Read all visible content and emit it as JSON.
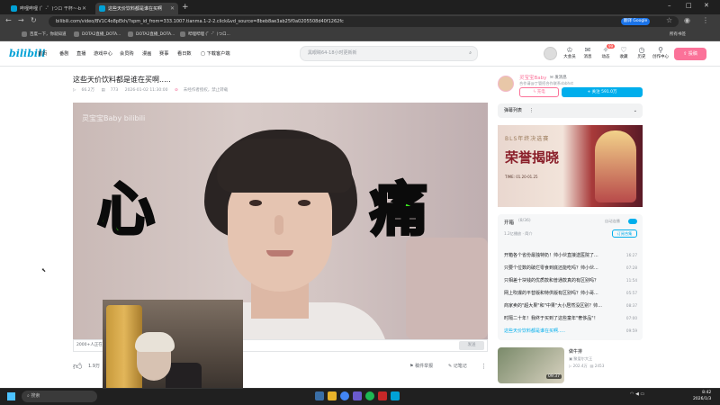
{
  "browser": {
    "tabs": [
      {
        "label": "哔哩哔哩 (゜-゜)つロ 干杯~-b",
        "active": false
      },
      {
        "label": "这些天价饮料都是谁在买啊",
        "active": true
      }
    ],
    "new_tab": "+",
    "window_controls": [
      "–",
      "□",
      "✕"
    ],
    "url": "bilibili.com/video/BV1C4o8pEkh/?spm_id_from=333.1007.tianma.1-2-2.click&vd_source=8beb8ae3ab25f0a0205508d40f1262fc",
    "google_button": "翻译 Google",
    "bookmarks": [
      "百度一下，你就知道",
      "DOTA2直播_DOTA...",
      "DOTA2直播_DOTA...",
      "哔哩哔哩 (゜-゜)つロ..."
    ],
    "all_bookmarks": "所有书签"
  },
  "header": {
    "logo": "bilibili",
    "nav": [
      "首页",
      "番剧",
      "直播",
      "游戏中心",
      "会员购",
      "漫画",
      "赛事",
      "看日数",
      "下载客户端"
    ],
    "search_placeholder": "黑眼睛64-18小时更新新",
    "icons": [
      {
        "label": "大会员",
        "icon": "vip-icon"
      },
      {
        "label": "消息",
        "icon": "message-icon"
      },
      {
        "label": "动态",
        "icon": "dynamic-icon"
      },
      {
        "label": "收藏",
        "icon": "favorite-icon"
      },
      {
        "label": "历史",
        "icon": "history-icon"
      },
      {
        "label": "创作中心",
        "icon": "creator-icon"
      }
    ],
    "badge": "99",
    "upload": "投稿"
  },
  "video": {
    "title": "这些天价饮料都是谁在买啊.....",
    "views": "66.2万",
    "danmaku": "773",
    "date": "2026-01-02 11:30:00",
    "copyright": "未经作者授权，禁止转载",
    "overlay_left": "心",
    "overlay_right": "痛",
    "watermark": "灵宝宝Baby bilibili",
    "danmaku_count": "2000+人正在看",
    "send": "发送",
    "likes": "1.9万",
    "actions": [
      "稿件举报",
      "记笔记"
    ]
  },
  "uploader": {
    "name": "灵宝宝Baby",
    "message": "发消息",
    "desc": "合作请@丁管招合作联系sbbhst",
    "charge": "充电",
    "follow": "+ 关注 591.0万"
  },
  "danmaku_list": {
    "label": "弹幕列表"
  },
  "ad": {
    "top": "BLS年终决选赛",
    "big": "荣誉揭晓",
    "time": "TIME: 01.20-01.25"
  },
  "playlist": {
    "title": "开箱",
    "count": "(8/36)",
    "auto": "自动连播",
    "sub": "1.2亿播放 · 简介",
    "subscribe": "订阅合集",
    "items": [
      {
        "title": "开箱各个省份最独特奶！帅小伙直接送医院了...",
        "duration": "16:27"
      },
      {
        "title": "只要个位数的破烂零食到底还能吃吗？帅小伙...",
        "duration": "07:28"
      },
      {
        "title": "只相差十块钱的优质款和普通款真的有区别吗？",
        "duration": "11:54"
      },
      {
        "title": "网上吹爆的平替版和特供版有区别吗？帅小哥...",
        "duration": "05:57"
      },
      {
        "title": "商家卖的\"超大果\"和\"中果\"大小居然没区别？帅...",
        "duration": "08:37"
      },
      {
        "title": "时隔二十年！我终于买到了这些童年\"奢侈品\"！",
        "duration": "07:00"
      },
      {
        "title": "这些天价饮料都是谁在买啊.....",
        "duration": "09:59"
      }
    ]
  },
  "recommend": {
    "title": "做牛排",
    "up": "聚爱尔大王",
    "views": "202.4万",
    "danmaku": "2453",
    "duration": "09:37"
  },
  "taskbar": {
    "search": "搜索",
    "time": "8:42",
    "date": "2026/1/3"
  }
}
